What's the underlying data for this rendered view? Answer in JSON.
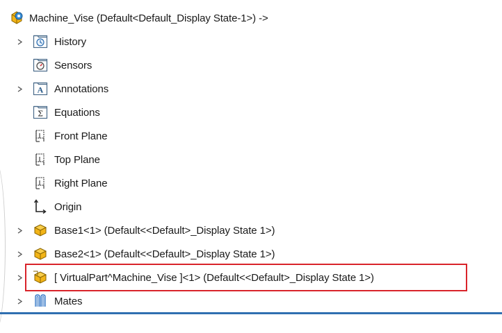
{
  "root": {
    "label": "Machine_Vise  (Default<Default_Display State-1>) ->",
    "icon": "assembly-icon"
  },
  "items": [
    {
      "label": "History",
      "icon": "history-folder-icon",
      "expandable": true
    },
    {
      "label": "Sensors",
      "icon": "sensors-folder-icon",
      "expandable": false
    },
    {
      "label": "Annotations",
      "icon": "annotations-folder-icon",
      "expandable": true
    },
    {
      "label": "Equations",
      "icon": "equations-folder-icon",
      "expandable": false
    },
    {
      "label": "Front Plane",
      "icon": "plane-icon",
      "expandable": false
    },
    {
      "label": "Top Plane",
      "icon": "plane-icon",
      "expandable": false
    },
    {
      "label": "Right Plane",
      "icon": "plane-icon",
      "expandable": false
    },
    {
      "label": "Origin",
      "icon": "origin-icon",
      "expandable": false
    },
    {
      "label": "Base1<1> (Default<<Default>_Display State 1>)",
      "icon": "part-icon",
      "expandable": true
    },
    {
      "label": "Base2<1> (Default<<Default>_Display State 1>)",
      "icon": "part-icon",
      "expandable": true
    },
    {
      "label": "[ VirtualPart^Machine_Vise ]<1> (Default<<Default>_Display State 1>)",
      "icon": "virtual-part-icon",
      "expandable": true,
      "highlighted": true
    },
    {
      "label": "Mates",
      "icon": "mates-icon",
      "expandable": true
    }
  ],
  "colors": {
    "highlight_border": "#d9232a",
    "part_yellow": "#f2b417",
    "bottom_line": "#2f6fb0"
  }
}
